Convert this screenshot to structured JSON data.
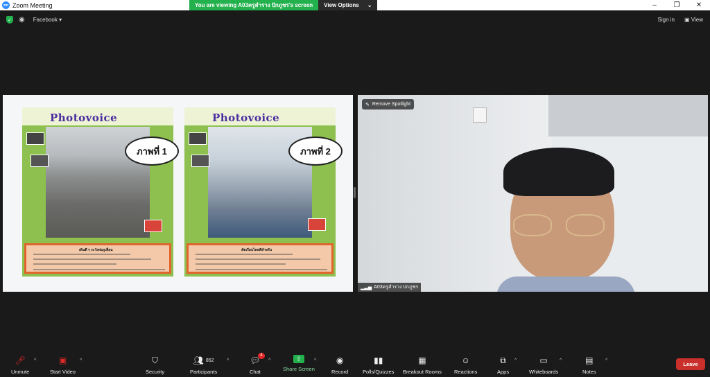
{
  "window": {
    "title": "Zoom Meeting"
  },
  "banner": {
    "message": "You are viewing A03ครูสำราง ปักภูชร's screen",
    "options": "View Options"
  },
  "topbar": {
    "meeting_app": "Facebook",
    "sign_in": "Sign in",
    "view": "View"
  },
  "share": {
    "posters": [
      {
        "title": "Photovoice",
        "bubble": "ภาพที่ 1",
        "caption": "เดินดี ๆ ระวังท่อภูเลื่อน"
      },
      {
        "title": "Photovoice",
        "bubble": "ภาพที่ 2",
        "caption": "ตัดเรียบไหลดีสำหรับ"
      }
    ]
  },
  "video": {
    "spotlight": "Remove Spotlight",
    "participant_name": "A03ครูสำราง ปกภูชร"
  },
  "toolbar": {
    "unmute": "Unmute",
    "start_video": "Start Video",
    "security": "Security",
    "participants": "Participants",
    "participants_count": "852",
    "chat": "Chat",
    "chat_badge": "4",
    "share_screen": "Share Screen",
    "record": "Record",
    "polls": "Polls/Quizzes",
    "breakout": "Breakout Rooms",
    "reactions": "Reactions",
    "apps": "Apps",
    "whiteboards": "Whiteboards",
    "notes": "Notes",
    "leave": "Leave"
  },
  "colors": {
    "accent": "#2d8cff",
    "share_green": "#23b14d",
    "leave_red": "#c9302c"
  }
}
